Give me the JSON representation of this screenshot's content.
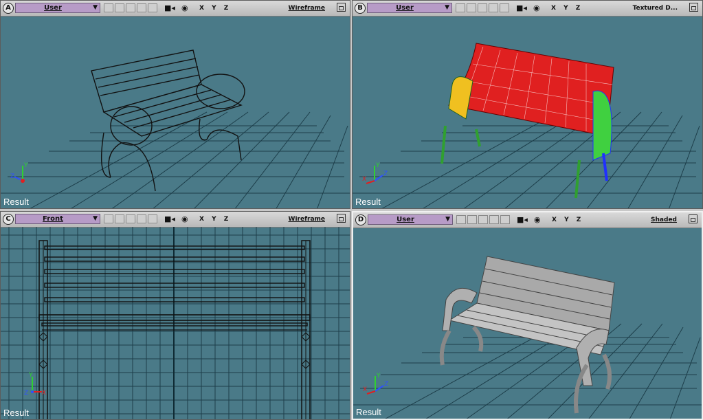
{
  "viewports": [
    {
      "letter": "A",
      "camera": "User",
      "mode": "Wireframe",
      "result": "Result"
    },
    {
      "letter": "B",
      "camera": "User",
      "mode": "Textured D...",
      "result": "Result"
    },
    {
      "letter": "C",
      "camera": "Front",
      "mode": "Wireframe",
      "result": "Result"
    },
    {
      "letter": "D",
      "camera": "User",
      "mode": "Shaded",
      "result": "Result"
    }
  ],
  "axes_label": "X Y Z",
  "gizmo": {
    "x": "X",
    "y": "Y",
    "z": "Z"
  },
  "colors": {
    "viewport_bg": "#4a7a88",
    "grid": "#1d3e4a",
    "camera_selector": "#b79bc7",
    "bench_red": "#e02020"
  }
}
